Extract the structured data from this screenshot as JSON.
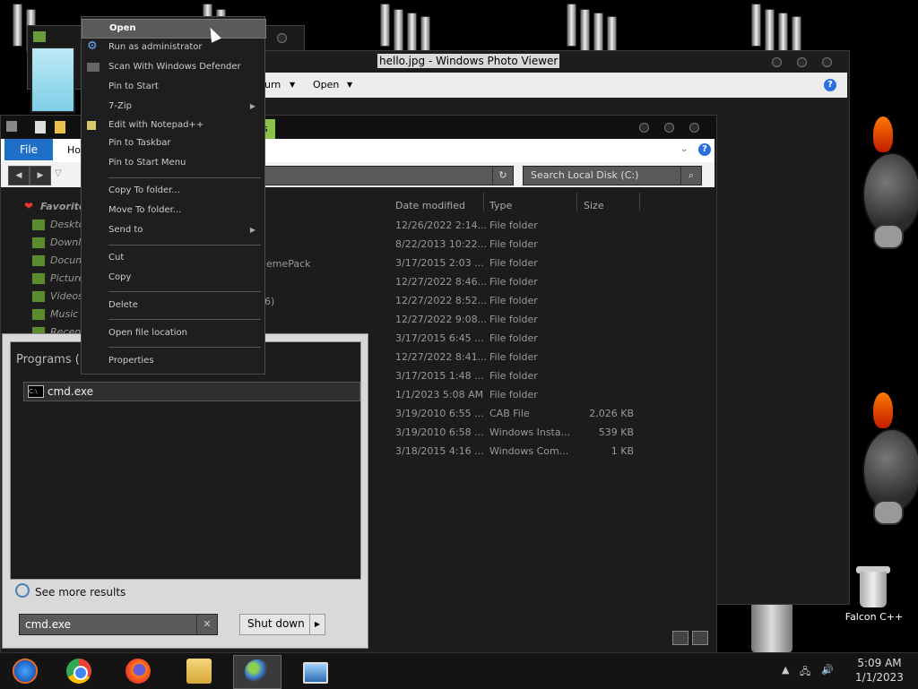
{
  "photo_viewer": {
    "title": "hello.jpg - Windows Photo Viewer",
    "toolbar": {
      "burn_partial": "urn",
      "open": "Open"
    }
  },
  "explorer": {
    "tabs": {
      "file": "File",
      "home_partial": "Ho"
    },
    "tab_tail": "s",
    "search_placeholder": "Search Local Disk (C:)",
    "columns": {
      "date": "Date modified",
      "type": "Type",
      "size": "Size"
    },
    "name_fragments": {
      "theme": "emePack",
      "six": "6)"
    },
    "nav": [
      "Favorites",
      "Deskto",
      "Downlo",
      "Docum",
      "Picture",
      "Videos",
      "Music",
      "Recent"
    ],
    "rows": [
      {
        "date": "12/26/2022 2:14...",
        "type": "File folder",
        "size": ""
      },
      {
        "date": "8/22/2013 10:22...",
        "type": "File folder",
        "size": ""
      },
      {
        "date": "3/17/2015 2:03 ...",
        "type": "File folder",
        "size": ""
      },
      {
        "date": "12/27/2022 8:46...",
        "type": "File folder",
        "size": ""
      },
      {
        "date": "12/27/2022 8:52...",
        "type": "File folder",
        "size": ""
      },
      {
        "date": "12/27/2022 9:08...",
        "type": "File folder",
        "size": ""
      },
      {
        "date": "3/17/2015 6:45 ...",
        "type": "File folder",
        "size": ""
      },
      {
        "date": "12/27/2022 8:41...",
        "type": "File folder",
        "size": ""
      },
      {
        "date": "3/17/2015 1:48 ...",
        "type": "File folder",
        "size": ""
      },
      {
        "date": "1/1/2023 5:08 AM",
        "type": "File folder",
        "size": ""
      },
      {
        "date": "3/19/2010 6:55 ...",
        "type": "CAB File",
        "size": "2,026 KB"
      },
      {
        "date": "3/19/2010 6:58 ...",
        "type": "Windows Insta...",
        "size": "539 KB"
      },
      {
        "date": "3/18/2015 4:16 ...",
        "type": "Windows Com...",
        "size": "1 KB"
      }
    ]
  },
  "context_menu": {
    "items": {
      "open": "Open",
      "run_admin": "Run as administrator",
      "scan": "Scan With Windows Defender",
      "pin_start": "Pin to Start",
      "zip": "7-Zip",
      "notepad": "Edit with Notepad++",
      "pin_taskbar": "Pin to Taskbar",
      "pin_start_menu": "Pin to Start Menu",
      "copy_to": "Copy To folder...",
      "move_to": "Move To folder...",
      "send_to": "Send to",
      "cut": "Cut",
      "copy": "Copy",
      "delete": "Delete",
      "open_location": "Open file location",
      "properties": "Properties"
    }
  },
  "start_menu": {
    "programs_header": "Programs (1",
    "program": "cmd.exe",
    "cmd_icon_text": "C:\\",
    "see_more": "See more results",
    "search_value": "cmd.exe",
    "shutdown": "Shut down"
  },
  "desktop": {
    "recycle_label": "Falcon C++"
  },
  "taskbar": {
    "time": "5:09 AM",
    "date": "1/1/2023"
  }
}
